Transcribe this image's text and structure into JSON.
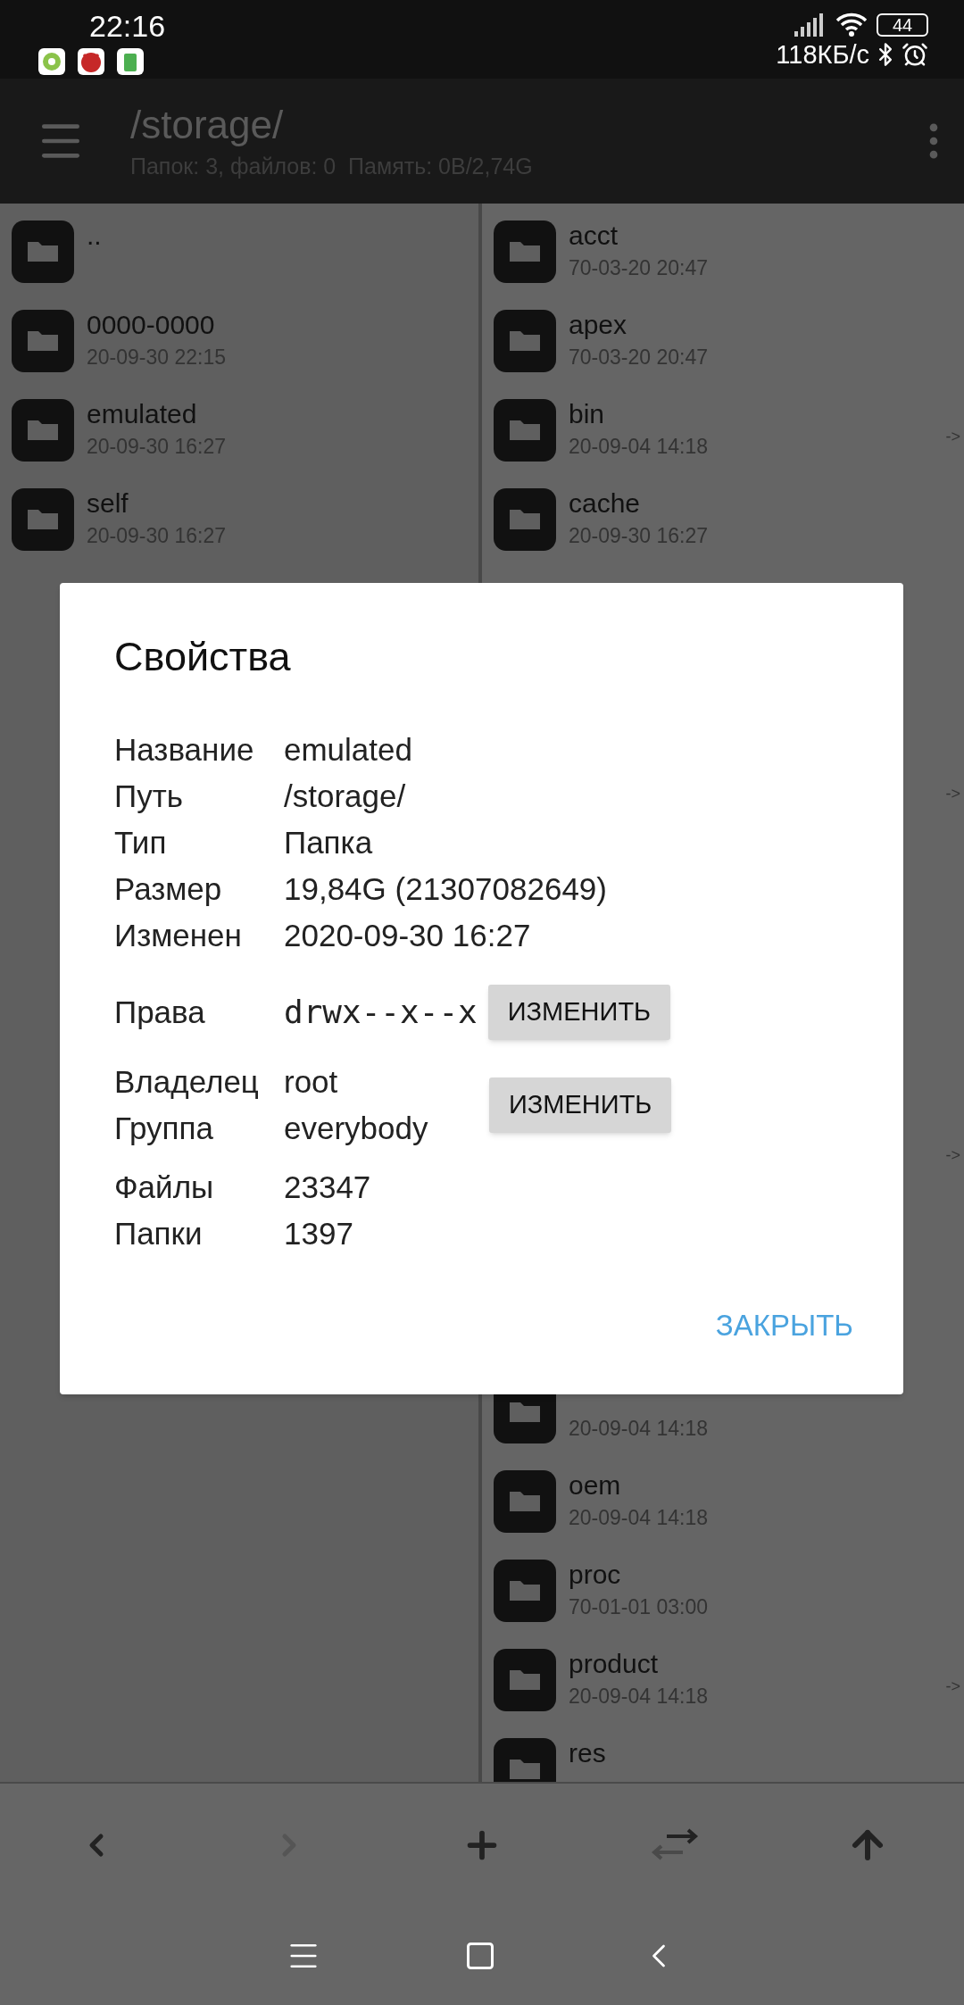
{
  "status_bar": {
    "time": "22:16",
    "network_speed": "118КБ/с",
    "battery": "44"
  },
  "app_bar": {
    "path": "/storage/",
    "summary": "Папок: 3, файлов: 0  Память: 0B/2,74G"
  },
  "left_panel": {
    "items": [
      {
        "name": ".."
      },
      {
        "name": "0000-0000",
        "date": "20-09-30 22:15"
      },
      {
        "name": "emulated",
        "date": "20-09-30 16:27"
      },
      {
        "name": "self",
        "date": "20-09-30 16:27"
      }
    ]
  },
  "right_panel": {
    "items_above_dialog": [
      {
        "name": "acct",
        "date": "70-03-20 20:47"
      },
      {
        "name": "apex",
        "date": "70-03-20 20:47"
      },
      {
        "name": "bin",
        "date": "20-09-04 14:18",
        "link_arrow": "->"
      },
      {
        "name": "cache",
        "date": "20-09-30 16:27"
      }
    ],
    "covered_link_arrows": [
      "->",
      "->"
    ],
    "items_below_dialog": [
      {
        "date": "20-09-04 14:18"
      },
      {
        "name": "oem",
        "date": "20-09-04 14:18"
      },
      {
        "name": "proc",
        "date": "70-01-01 03:00"
      },
      {
        "name": "product",
        "date": "20-09-04 14:18",
        "link_arrow": "->"
      },
      {
        "name": "res"
      }
    ]
  },
  "dialog": {
    "title": "Свойства",
    "properties": [
      {
        "label": "Название",
        "value": "emulated"
      },
      {
        "label": "Путь",
        "value": "/storage/"
      },
      {
        "label": "Тип",
        "value": "Папка"
      },
      {
        "label": "Размер",
        "value": "19,84G (21307082649)"
      },
      {
        "label": "Изменен",
        "value": "2020-09-30 16:27"
      }
    ],
    "permissions": {
      "label": "Права",
      "value": "drwx--x--x",
      "button": "ИЗМЕНИТЬ"
    },
    "ownership": {
      "rows": [
        {
          "label": "Владелец",
          "value": "root"
        },
        {
          "label": "Группа",
          "value": "everybody"
        }
      ],
      "button": "ИЗМЕНИТЬ"
    },
    "counts": [
      {
        "label": "Файлы",
        "value": "23347"
      },
      {
        "label": "Папки",
        "value": "1397"
      }
    ],
    "close_button": "ЗАКРЫТЬ"
  },
  "toolbar": [
    {
      "kind": "back",
      "disabled": false
    },
    {
      "kind": "forward",
      "disabled": true
    },
    {
      "kind": "add",
      "disabled": false
    },
    {
      "kind": "swap",
      "disabled": false
    },
    {
      "kind": "up",
      "disabled": false
    }
  ]
}
